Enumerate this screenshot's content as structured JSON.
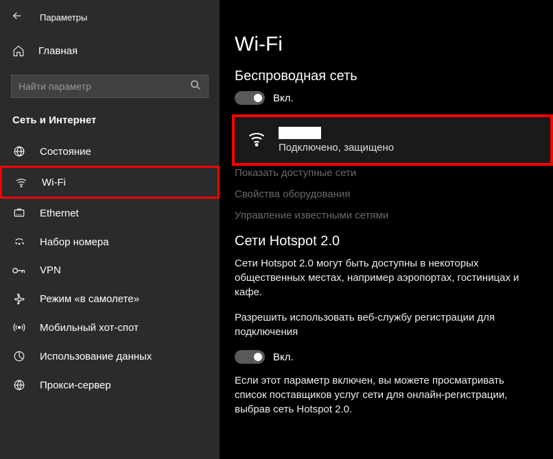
{
  "header": {
    "title": "Параметры"
  },
  "home": {
    "label": "Главная"
  },
  "search": {
    "placeholder": "Найти параметр"
  },
  "section": {
    "label": "Сеть и Интернет"
  },
  "sidebar": {
    "items": [
      {
        "label": "Состояние",
        "icon": "status"
      },
      {
        "label": "Wi-Fi",
        "icon": "wifi",
        "highlighted": true
      },
      {
        "label": "Ethernet",
        "icon": "ethernet"
      },
      {
        "label": "Набор номера",
        "icon": "dialup"
      },
      {
        "label": "VPN",
        "icon": "vpn"
      },
      {
        "label": "Режим «в самолете»",
        "icon": "airplane"
      },
      {
        "label": "Мобильный хот-спот",
        "icon": "hotspot"
      },
      {
        "label": "Использование данных",
        "icon": "datausage"
      },
      {
        "label": "Прокси-сервер",
        "icon": "proxy"
      }
    ]
  },
  "main": {
    "title": "Wi-Fi",
    "wireless_heading": "Беспроводная сеть",
    "toggle_on_label": "Вкл.",
    "network": {
      "status": "Подключено, защищено"
    },
    "links": {
      "show_networks": "Показать доступные сети",
      "hardware_props": "Свойства оборудования",
      "manage_known": "Управление известными сетями"
    },
    "hotspot": {
      "heading": "Сети Hotspot 2.0",
      "desc": "Сети Hotspot 2.0 могут быть доступны в некоторых общественных местах, например аэропортах, гостиницах и кафе.",
      "allow_text": "Разрешить использовать веб-службу регистрации для подключения",
      "toggle_label": "Вкл.",
      "note": "Если этот параметр включен, вы можете просматривать список поставщиков услуг сети для онлайн-регистрации, выбрав сеть Hotspot 2.0."
    }
  }
}
